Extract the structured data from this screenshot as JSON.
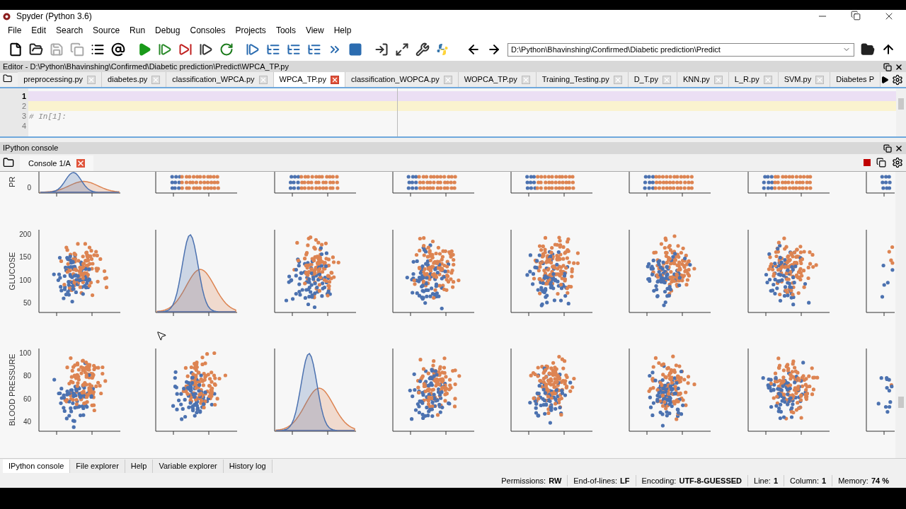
{
  "window": {
    "title": "Spyder (Python 3.6)"
  },
  "menu": [
    "File",
    "Edit",
    "Search",
    "Source",
    "Run",
    "Debug",
    "Consoles",
    "Projects",
    "Tools",
    "View",
    "Help"
  ],
  "path_field": {
    "value": "D:\\Python\\Bhavinshing\\Confirmed\\Diabetic prediction\\Predict"
  },
  "editor": {
    "title": "Editor - D:\\Python\\Bhavinshing\\Confirmed\\Diabetic prediction\\Predict\\WPCA_TP.py",
    "tabs": [
      {
        "label": "preprocessing.py",
        "selected": false
      },
      {
        "label": "diabetes.py",
        "selected": false
      },
      {
        "label": "classification_WPCA.py",
        "selected": false
      },
      {
        "label": "WPCA_TP.py",
        "selected": true
      },
      {
        "label": "classification_WOPCA.py",
        "selected": false
      },
      {
        "label": "WOPCA_TP.py",
        "selected": false
      },
      {
        "label": "Training_Testing.py",
        "selected": false
      },
      {
        "label": "D_T.py",
        "selected": false
      },
      {
        "label": "KNN.py",
        "selected": false
      },
      {
        "label": "L_R.py",
        "selected": false
      },
      {
        "label": "SVM.py",
        "selected": false
      },
      {
        "label": "Diabetes P",
        "selected": false
      }
    ],
    "lines": [
      {
        "number": "1",
        "current": true,
        "highlighted": true
      },
      {
        "number": "2",
        "current": false,
        "highlighted": true
      },
      {
        "number": "3",
        "current": false,
        "highlighted": false,
        "text": "# In[1]:"
      },
      {
        "number": "4",
        "current": false,
        "highlighted": false
      }
    ]
  },
  "console": {
    "title": "IPython console",
    "tabs": [
      {
        "label": "Console 1/A",
        "selected": true
      }
    ],
    "pairplot": {
      "rows": [
        {
          "ylabel": "PR",
          "yticks": [
            "0"
          ],
          "cells": [
            {
              "kind": "density"
            },
            {
              "kind": "strip"
            },
            {
              "kind": "strip"
            },
            {
              "kind": "strip"
            },
            {
              "kind": "strip"
            },
            {
              "kind": "strip"
            },
            {
              "kind": "strip"
            },
            {
              "kind": "strip"
            }
          ]
        },
        {
          "ylabel": "GLUCOSE",
          "yticks": [
            "200",
            "150",
            "100",
            "50"
          ],
          "cells": [
            {
              "kind": "scatter"
            },
            {
              "kind": "density"
            },
            {
              "kind": "scatter"
            },
            {
              "kind": "scatter"
            },
            {
              "kind": "scatter"
            },
            {
              "kind": "scatter"
            },
            {
              "kind": "scatter"
            },
            {
              "kind": "scatter"
            }
          ]
        },
        {
          "ylabel": "BLOOD PRESSURE",
          "yticks": [
            "100",
            "80",
            "60",
            "40"
          ],
          "cells": [
            {
              "kind": "scatter"
            },
            {
              "kind": "scatter"
            },
            {
              "kind": "density"
            },
            {
              "kind": "scatter"
            },
            {
              "kind": "scatter"
            },
            {
              "kind": "scatter"
            },
            {
              "kind": "scatter"
            },
            {
              "kind": "scatter"
            }
          ]
        }
      ]
    }
  },
  "bottom_tabs": [
    {
      "label": "IPython console",
      "selected": true
    },
    {
      "label": "File explorer",
      "selected": false
    },
    {
      "label": "Help",
      "selected": false
    },
    {
      "label": "Variable explorer",
      "selected": false
    },
    {
      "label": "History log",
      "selected": false
    }
  ],
  "status_bar": [
    {
      "label": "Permissions:",
      "value": "RW"
    },
    {
      "label": "End-of-lines:",
      "value": "LF"
    },
    {
      "label": "Encoding:",
      "value": "UTF-8-GUESSED"
    },
    {
      "label": "Line:",
      "value": "1"
    },
    {
      "label": "Column:",
      "value": "1"
    },
    {
      "label": "Memory:",
      "value": "74 %"
    }
  ]
}
